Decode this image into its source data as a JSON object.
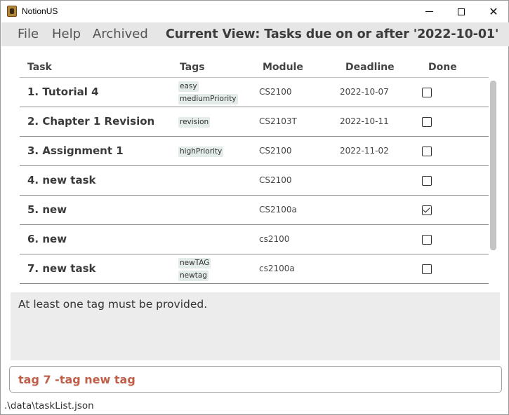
{
  "window": {
    "title": "NotionUS",
    "controls": {
      "minimize_icon": "minimize-icon",
      "maximize_icon": "maximize-icon",
      "close_glyph": "✕"
    }
  },
  "menu": {
    "file": "File",
    "help": "Help",
    "archived": "Archived",
    "current_view": "Current View: Tasks due on or after '2022-10-01'"
  },
  "table": {
    "headers": {
      "task": "Task",
      "tags": "Tags",
      "module": "Module",
      "deadline": "Deadline",
      "done": "Done"
    },
    "rows": [
      {
        "task": "1. Tutorial 4",
        "tags": [
          "easy",
          "mediumPriority"
        ],
        "module": "CS2100",
        "deadline": "2022-10-07",
        "done": false
      },
      {
        "task": "2. Chapter 1 Revision",
        "tags": [
          "revision"
        ],
        "module": "CS2103T",
        "deadline": "2022-10-11",
        "done": false
      },
      {
        "task": "3. Assignment 1",
        "tags": [
          "highPriority"
        ],
        "module": "CS2100",
        "deadline": "2022-11-02",
        "done": false
      },
      {
        "task": "4. new task",
        "tags": [],
        "module": "CS2100",
        "deadline": "",
        "done": false
      },
      {
        "task": "5. new",
        "tags": [],
        "module": "CS2100a",
        "deadline": "",
        "done": true
      },
      {
        "task": "6. new",
        "tags": [],
        "module": "cs2100",
        "deadline": "",
        "done": false
      },
      {
        "task": "7. new task",
        "tags": [
          "newTAG",
          "newtag"
        ],
        "module": "cs2100a",
        "deadline": "",
        "done": false
      }
    ]
  },
  "result": {
    "message": "At least one tag must be provided."
  },
  "command": {
    "value": "tag 7 -tag new tag"
  },
  "status": {
    "file_path": ".\\data\\taskList.json"
  },
  "colors": {
    "command_text": "#c0604a",
    "tag_bg": "#e3ece8",
    "menubar_bg": "#e6e6e6",
    "result_bg": "#ececec"
  }
}
